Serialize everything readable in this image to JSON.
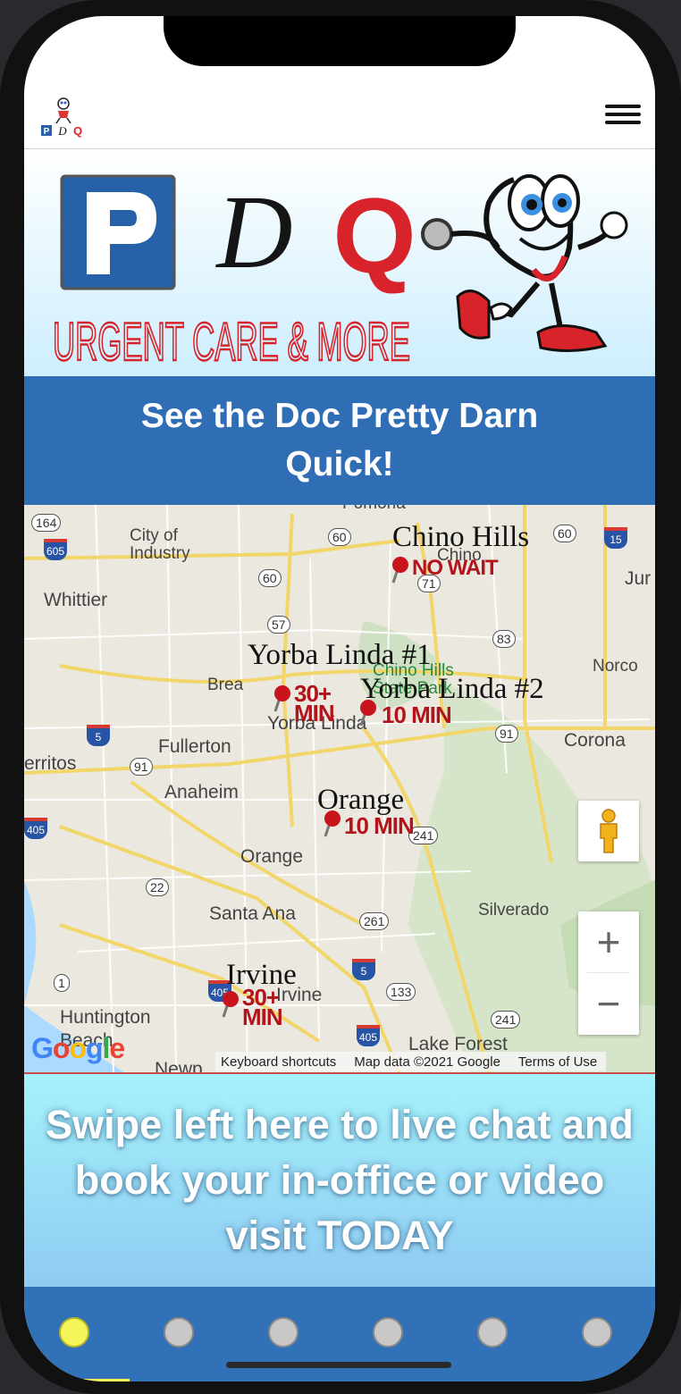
{
  "header": {
    "mini_logo_letters": [
      "P",
      "D",
      "Q"
    ]
  },
  "hero": {
    "logo_letters": [
      "P",
      "D",
      "Q"
    ],
    "logo_subtitle": "URGENT CARE & MORE",
    "mascot": "stethoscope-mascot-icon"
  },
  "tagline": "See the Doc Pretty Darn Quick!",
  "map": {
    "places": {
      "city_of_industry": "City of\nIndustry",
      "whittier": "Whittier",
      "brea": "Brea",
      "fullerton": "Fullerton",
      "anaheim": "Anaheim",
      "orange_city": "Orange",
      "santa_ana": "Santa Ana",
      "huntington_beach": "Huntington\nBeach",
      "irvine_city": "Irvine",
      "chino": "Chino",
      "chino_hills_park": "Chino Hills\nState Park",
      "yorba_linda_city": "Yorba Linda",
      "norco": "Norco",
      "corona": "Corona",
      "silverado": "Silverado",
      "lake_forest": "Lake Forest",
      "cerritos": "erritos",
      "jurupa": "Jur",
      "newport": "Newp",
      "pomona": "Pomona"
    },
    "routes": [
      "164",
      "605",
      "60",
      "60",
      "60",
      "71",
      "57",
      "83",
      "15",
      "5",
      "91",
      "91",
      "405",
      "22",
      "261",
      "241",
      "1",
      "5",
      "133",
      "405",
      "241",
      "405"
    ],
    "locations": [
      {
        "name": "Chino Hills",
        "wait": "NO WAIT"
      },
      {
        "name": "Yorba Linda #1",
        "wait": "30+\nMIN"
      },
      {
        "name": "Yorba Linda #2",
        "wait": "10 MIN"
      },
      {
        "name": "Orange",
        "wait": "10 MIN"
      },
      {
        "name": "Irvine",
        "wait": "30+\nMIN"
      }
    ],
    "controls": {
      "pegman": "pegman-icon",
      "zoom_in": "+",
      "zoom_out": "−"
    },
    "google_logo": "Google",
    "attribution": {
      "shortcuts": "Keyboard shortcuts",
      "map_data": "Map data ©2021 Google",
      "terms": "Terms of Use"
    }
  },
  "cta": "Swipe left here to live chat and book your in-office or video visit TODAY",
  "pagination": {
    "count": 6,
    "active_index": 0
  }
}
